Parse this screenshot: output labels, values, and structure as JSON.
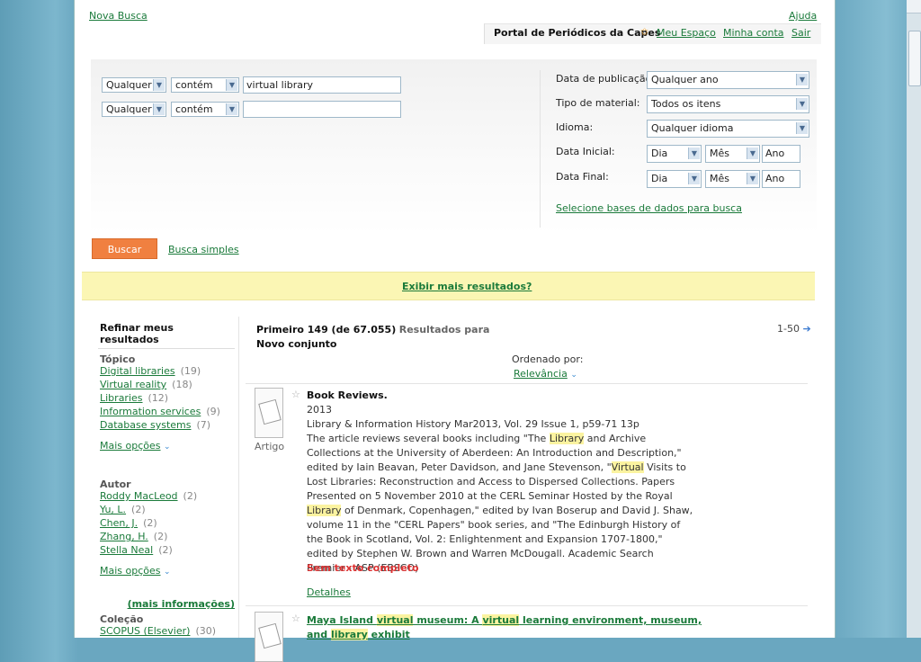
{
  "top": {
    "nova_busca": "Nova Busca",
    "ajuda": "Ajuda",
    "portal_title": "Portal de Periódicos da Capes",
    "meu_espaco": "Meu Espaço",
    "minha_conta": "Minha conta",
    "sair": "Sair"
  },
  "search": {
    "row1": {
      "field": "Qualquer",
      "op": "contém",
      "value": "virtual library"
    },
    "row2": {
      "field": "Qualquer",
      "op": "contém",
      "value": ""
    },
    "data_pub_label": "Data de publicação:",
    "data_pub_value": "Qualquer ano",
    "tipo_label": "Tipo de material:",
    "tipo_value": "Todos os itens",
    "idioma_label": "Idioma:",
    "idioma_value": "Qualquer idioma",
    "data_inicial_label": "Data Inicial:",
    "data_final_label": "Data Final:",
    "dia": "Dia",
    "mes": "Mês",
    "ano": "Ano",
    "selecione_bases": "Selecione bases de dados para busca",
    "buscar": "Buscar",
    "busca_simples": "Busca simples"
  },
  "banner": {
    "exibir_mais": "Exibir mais resultados?"
  },
  "refine": {
    "heading": "Refinar meus resultados",
    "topico_label": "Tópico",
    "topics": [
      {
        "label": "Digital libraries",
        "count": "(19)"
      },
      {
        "label": "Virtual reality",
        "count": "(18)"
      },
      {
        "label": "Libraries",
        "count": "(12)"
      },
      {
        "label": "Information services",
        "count": "(9)"
      },
      {
        "label": "Database systems",
        "count": "(7)"
      }
    ],
    "mais_opcoes": "Mais opções",
    "autor_label": "Autor",
    "authors": [
      {
        "label": "Roddy MacLeod",
        "count": "(2)"
      },
      {
        "label": "Yu, L.",
        "count": "(2)"
      },
      {
        "label": "Chen, J.",
        "count": "(2)"
      },
      {
        "label": "Zhang, H.",
        "count": "(2)"
      },
      {
        "label": "Stella Neal",
        "count": "(2)"
      }
    ],
    "mais_info": "(mais informações)",
    "colecao_label": "Coleção",
    "collections": [
      {
        "label": "SCOPUS (Elsevier)",
        "count": "(30)"
      }
    ]
  },
  "results": {
    "header_primeiro": "Primeiro 149 (de 67.055)",
    "header_resultados": "Resultados para",
    "header_novo": "Novo conjunto",
    "pager": "1-50",
    "ordenado_label": "Ordenado por:",
    "ordenado_value": "Relevância",
    "item1": {
      "type": "Artigo",
      "title": "Book Reviews.",
      "year": "2013",
      "line1": "Library & Information History Mar2013, Vol. 29 Issue 1, p59-71 13p",
      "availability": "Sem texto completo",
      "details": "Detalhes"
    },
    "item2": {
      "title_a": "Maya Island ",
      "title_b": "virtual",
      "title_c": " museum: A ",
      "title_d": "virtual",
      "title_e": " learning environment, museum, and ",
      "title_f": "library",
      "title_g": " exhibit"
    }
  }
}
